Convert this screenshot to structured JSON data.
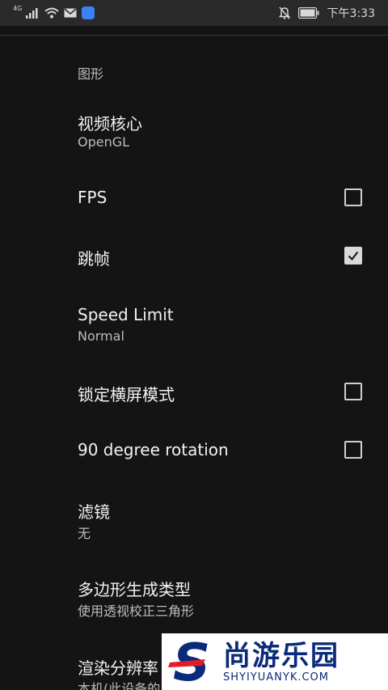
{
  "status_bar": {
    "network_label": "4G",
    "time": "下午3:33",
    "icons": [
      "signal-icon",
      "wifi-icon",
      "mail-icon",
      "app-badge-icon",
      "mute-notification-icon",
      "battery-icon"
    ]
  },
  "section": {
    "title": "图形"
  },
  "settings": {
    "video_core": {
      "title": "视频核心",
      "summary": "OpenGL"
    },
    "fps": {
      "title": "FPS",
      "checked": false
    },
    "frame_skip": {
      "title": "跳帧",
      "checked": true
    },
    "speed_limit": {
      "title": "Speed Limit",
      "summary": "Normal"
    },
    "lock_landscape": {
      "title": "锁定横屏模式",
      "checked": false
    },
    "rotation_90": {
      "title": "90 degree rotation",
      "checked": false
    },
    "filter": {
      "title": "滤镜",
      "summary": "无"
    },
    "polygon_gen": {
      "title": "多边形生成类型",
      "summary": "使用透视校正三角形"
    },
    "render_resolution": {
      "title": "渲染分辨率",
      "summary": "本机(此设备的"
    }
  },
  "watermark": {
    "cn": "尚游乐园",
    "en": "SHYIYUANYK.COM",
    "logo_letter": "S"
  },
  "colors": {
    "background": "#141414",
    "status_bar": "#2a2a2a",
    "watermark_text": "#0a2a7a"
  }
}
